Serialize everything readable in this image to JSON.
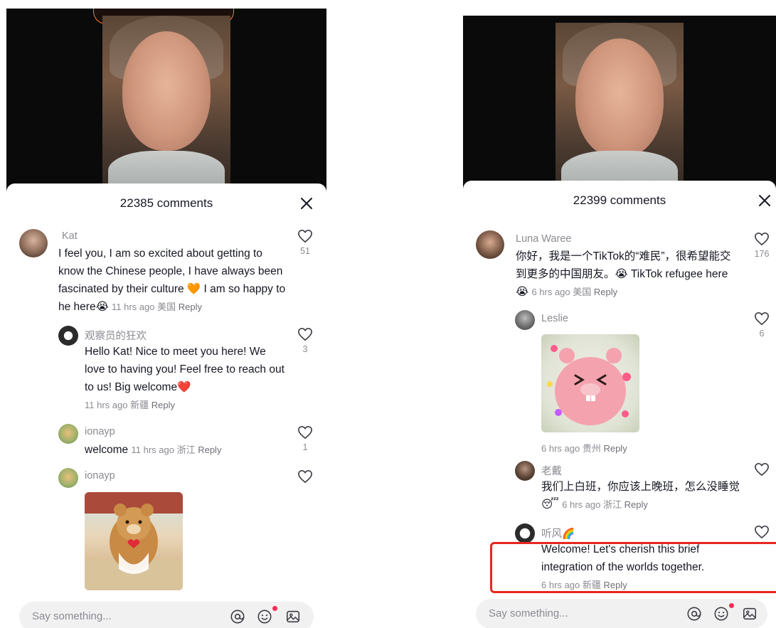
{
  "left": {
    "comment_count": "22385 comments",
    "comments": [
      {
        "user": "Kat",
        "text": "I feel you, I am so excited about getting to know the Chinese people, I have always been fascinated by their culture 🧡 I am so happy to he here😭",
        "meta": "11 hrs ago 美国",
        "reply": "Reply",
        "likes": "51"
      },
      {
        "user": "观察员的狂欢",
        "text": "Hello Kat! Nice to meet you here! We love to having you! Feel free to reach out to us! Big welcome❤️",
        "meta": "11 hrs ago 新疆",
        "reply": "Reply",
        "likes": "3"
      },
      {
        "user": "ionayp",
        "text": "welcome",
        "meta": "11 hrs ago 浙江",
        "reply": "Reply",
        "likes": "1"
      },
      {
        "user": "ionayp",
        "text": "",
        "meta": "",
        "reply": "",
        "likes": ""
      }
    ],
    "input_placeholder": "Say something..."
  },
  "right": {
    "comment_count": "22399 comments",
    "comments": [
      {
        "user": "Luna Waree",
        "text": "你好，我是一个TikTok的“难民”，很希望能交到更多的中国朋友。😭 TikTok refugee here 😭",
        "meta": "6 hrs ago 美国",
        "reply": "Reply",
        "likes": "176"
      },
      {
        "user": "Leslie",
        "text": "",
        "meta": "6 hrs ago 贵州",
        "reply": "Reply",
        "likes": "6"
      },
      {
        "user": "老戴",
        "text": "我们上白班，你应该上晚班，怎么没睡觉😴",
        "meta": "6 hrs ago 浙江",
        "reply": "Reply",
        "likes": ""
      },
      {
        "user": "听风🌈",
        "text": "Welcome! Let's cherish this brief integration of the worlds together.",
        "meta": "6 hrs ago 新疆",
        "reply": "Reply",
        "likes": ""
      }
    ],
    "input_placeholder": "Say something..."
  },
  "colors": {
    "highlight": "#e8261f",
    "notify_dot": "#fe2c55"
  },
  "icons": [
    "close-icon",
    "heart-outline-icon",
    "at-icon",
    "emoji-icon",
    "image-icon"
  ]
}
